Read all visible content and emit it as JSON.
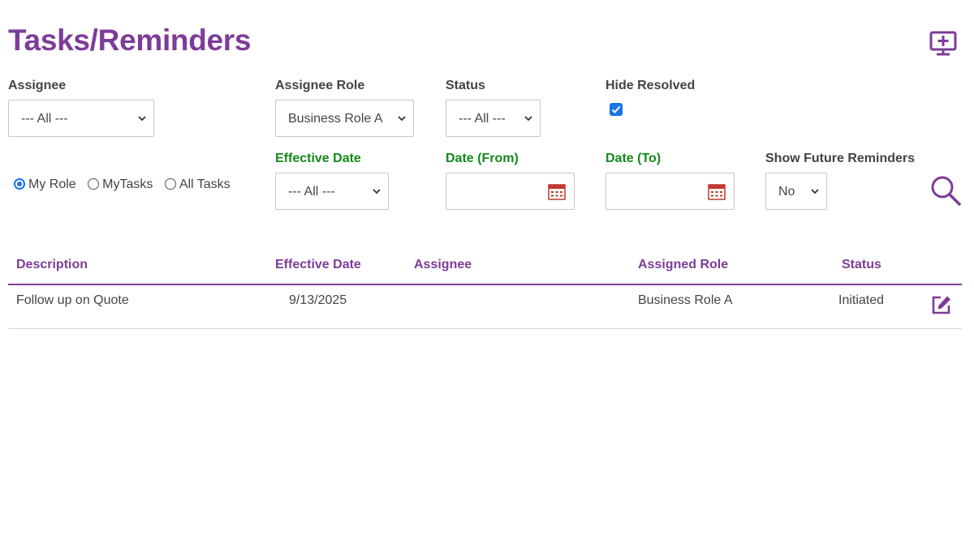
{
  "page": {
    "title": "Tasks/Reminders"
  },
  "filters": {
    "assignee": {
      "label": "Assignee",
      "value": "--- All ---"
    },
    "assignee_role": {
      "label": "Assignee Role",
      "value": "Business Role A"
    },
    "status": {
      "label": "Status",
      "value": "--- All ---"
    },
    "hide_resolved": {
      "label": "Hide Resolved",
      "checked": true
    },
    "scope": {
      "options": [
        {
          "label": "My Role",
          "selected": true
        },
        {
          "label": "MyTasks",
          "selected": false
        },
        {
          "label": "All Tasks",
          "selected": false
        }
      ]
    },
    "effective_date": {
      "label": "Effective Date",
      "value": "--- All ---"
    },
    "date_from": {
      "label": "Date (From)",
      "value": ""
    },
    "date_to": {
      "label": "Date (To)",
      "value": ""
    },
    "show_future": {
      "label": "Show Future Reminders",
      "value": "No"
    }
  },
  "table": {
    "columns": [
      "Description",
      "Effective Date",
      "Assignee",
      "Assigned Role",
      "Status"
    ],
    "rows": [
      {
        "description": "Follow up on Quote",
        "effective_date": "9/13/2025",
        "assignee": "",
        "assigned_role": "Business Role A",
        "status": "Initiated"
      }
    ]
  },
  "icons": {
    "add": "add-screen-icon",
    "search": "search-icon",
    "edit": "edit-icon",
    "calendar": "calendar-icon",
    "chevron": "chevron-down-icon"
  },
  "colors": {
    "accent": "#7d3c98",
    "green_label": "#138a1a",
    "checkbox": "#1a73e8",
    "calendar": "#c0392b"
  }
}
